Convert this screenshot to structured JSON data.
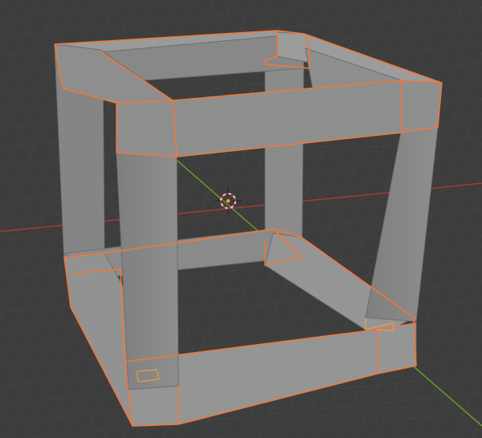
{
  "viewport": {
    "mode": "3D Viewport",
    "background_color": "#3d3d3d",
    "grid_color": "#4a4a4a",
    "axis_x_color": "#a33a3a",
    "axis_y_color": "#6a9a2a",
    "selection_outline_color": "#f0783a",
    "selection_highlight_color": "#f6a23b"
  },
  "scene": {
    "objects": [
      {
        "name": "frame-cube",
        "selected": true,
        "shading": "solid",
        "wireframe_overlay": true
      }
    ],
    "cursor": {
      "icon": "3d-cursor-icon"
    },
    "origin": {
      "icon": "object-origin-icon",
      "color": "#f6a23b"
    }
  }
}
